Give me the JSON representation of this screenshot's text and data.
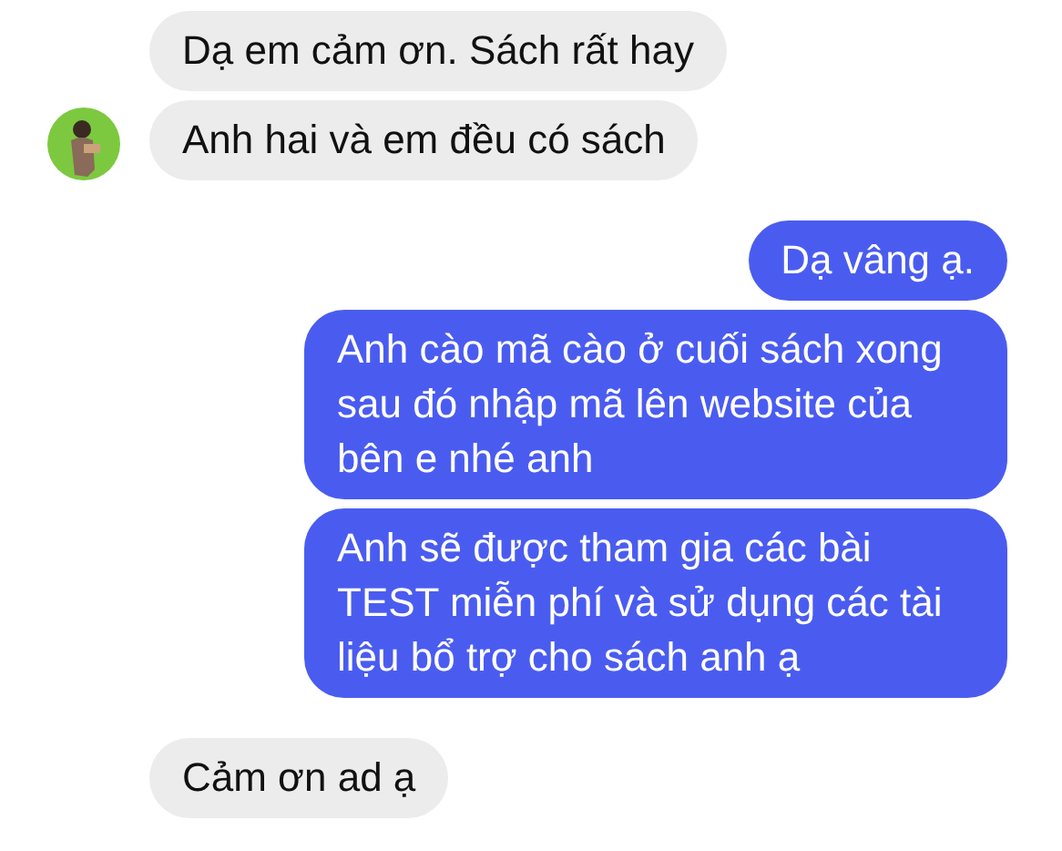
{
  "messages": [
    {
      "kind": "incoming",
      "avatar": false,
      "text": "Dạ em cảm ơn. Sách rất hay"
    },
    {
      "kind": "incoming",
      "avatar": true,
      "text": "Anh hai và em đều có sách"
    },
    {
      "kind": "outgoing",
      "avatar": false,
      "text": "Dạ vâng ạ."
    },
    {
      "kind": "outgoing",
      "avatar": false,
      "text": "Anh cào mã cào ở cuối sách xong sau đó nhập mã lên website của bên e nhé anh"
    },
    {
      "kind": "outgoing",
      "avatar": false,
      "text": "Anh sẽ được tham gia các bài TEST miễn phí và sử dụng các tài liệu bổ trợ cho sách anh ạ"
    },
    {
      "kind": "incoming",
      "avatar": false,
      "text": "Cảm ơn ad ạ"
    }
  ]
}
